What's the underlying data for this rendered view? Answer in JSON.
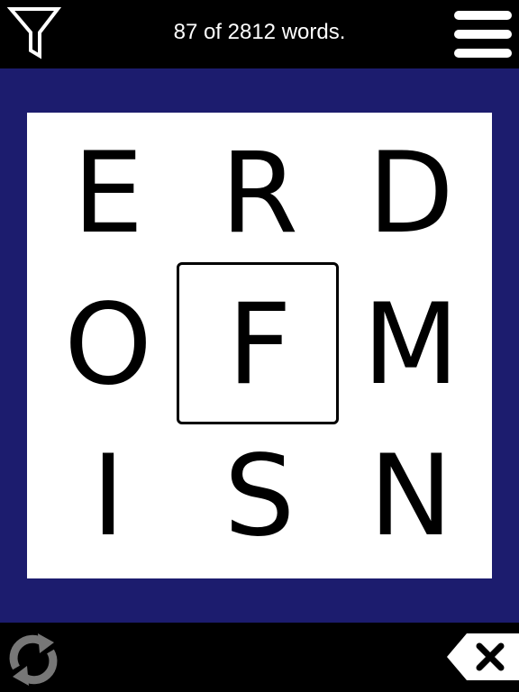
{
  "header": {
    "word_count": "87 of 2812 words.",
    "filter_icon": "filter-funnel-icon",
    "menu_icon": "hamburger-menu-icon"
  },
  "board": {
    "tiles": [
      {
        "letter": "E"
      },
      {
        "letter": "R"
      },
      {
        "letter": "D"
      },
      {
        "letter": "O"
      },
      {
        "letter": "F"
      },
      {
        "letter": "M"
      },
      {
        "letter": "I"
      },
      {
        "letter": "S"
      },
      {
        "letter": "N"
      }
    ],
    "center_letter_index": 4
  },
  "footer": {
    "refresh_icon": "refresh-icon",
    "backspace_icon": "backspace-icon"
  },
  "colors": {
    "background": "#000000",
    "frame": "#1c1c6e",
    "board": "#ffffff",
    "text": "#ffffff",
    "refresh_icon": "#777777"
  }
}
